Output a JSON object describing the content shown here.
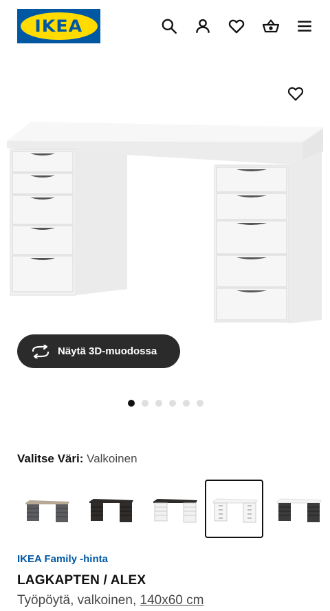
{
  "header": {
    "logo_text": "IKEA",
    "icons": [
      "search-icon",
      "account-icon",
      "favorites-icon",
      "cart-icon",
      "menu-icon"
    ]
  },
  "gallery": {
    "view3d_label": "Näytä 3D-muodossa",
    "dots_total": 6,
    "dots_active_index": 0
  },
  "color": {
    "label": "Valitse Väri:",
    "value": "Valkoinen",
    "swatches": [
      {
        "name": "grey-turquoise",
        "selected": false
      },
      {
        "name": "black-brown",
        "selected": false
      },
      {
        "name": "black-brown-white",
        "selected": false
      },
      {
        "name": "white",
        "selected": true
      },
      {
        "name": "white-anthracite",
        "selected": false
      }
    ]
  },
  "product": {
    "family_price": "IKEA Family -hinta",
    "name": "LAGKAPTEN / ALEX",
    "description_prefix": "Työpöytä, valkoinen,",
    "dimensions": "140x60 cm"
  },
  "colors": {
    "brand_blue": "#0058a3",
    "brand_yellow": "#ffdb00",
    "button_dark": "#2b2b2b"
  }
}
